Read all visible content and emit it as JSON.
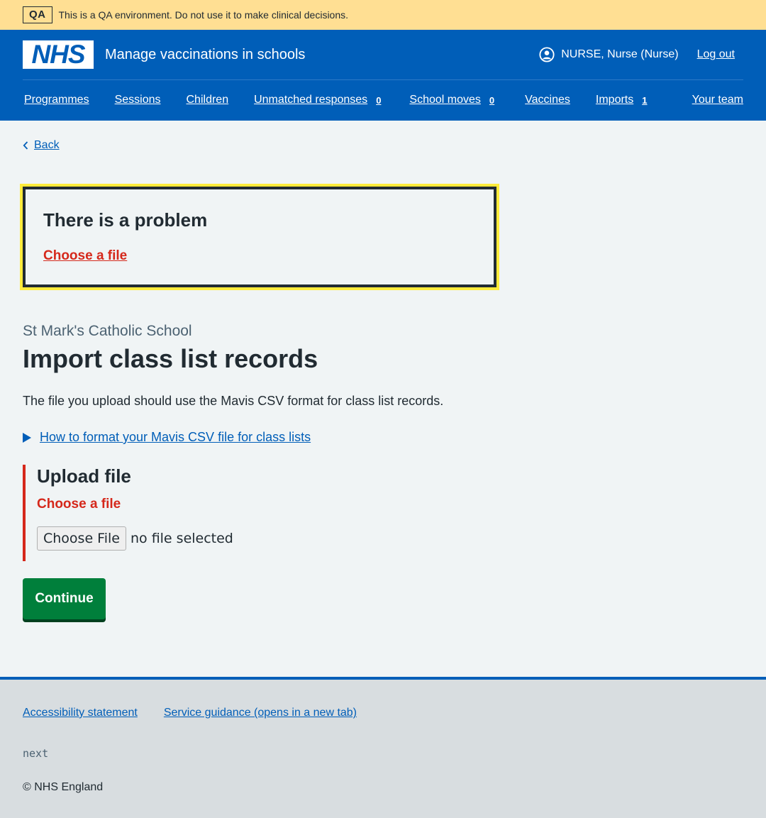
{
  "qa_banner": {
    "tag": "QA",
    "message": "This is a QA environment. Do not use it to make clinical decisions."
  },
  "header": {
    "logo_text": "NHS",
    "service_name": "Manage vaccinations in schools",
    "user": "NURSE, Nurse (Nurse)",
    "logout": "Log out",
    "nav": [
      {
        "label": "Programmes",
        "count": ""
      },
      {
        "label": "Sessions",
        "count": ""
      },
      {
        "label": "Children",
        "count": ""
      },
      {
        "label": "Unmatched responses",
        "count": "0"
      },
      {
        "label": "School moves",
        "count": "0"
      },
      {
        "label": "Vaccines",
        "count": ""
      },
      {
        "label": "Imports",
        "count": "1"
      },
      {
        "label": "Your team",
        "count": ""
      }
    ]
  },
  "back_link": "Back",
  "error_summary": {
    "title": "There is a problem",
    "link": "Choose a file"
  },
  "caption": "St Mark's Catholic School",
  "title": "Import class list records",
  "intro": "The file you upload should use the Mavis CSV format for class list records.",
  "details_summary": "How to format your Mavis CSV file for class lists",
  "upload": {
    "label": "Upload file",
    "error": "Choose a file",
    "button": "Choose File",
    "status": "no file selected"
  },
  "continue": "Continue",
  "footer": {
    "links": [
      "Accessibility statement",
      "Service guidance (opens in a new tab)"
    ],
    "version": "next",
    "copyright": "© NHS England"
  },
  "colors": {
    "nhs_blue": "#005eb8",
    "error_red": "#d5281b",
    "success_green": "#007f3b",
    "focus_yellow": "#ffeb3b",
    "qa_yellow": "#ffdf93"
  }
}
